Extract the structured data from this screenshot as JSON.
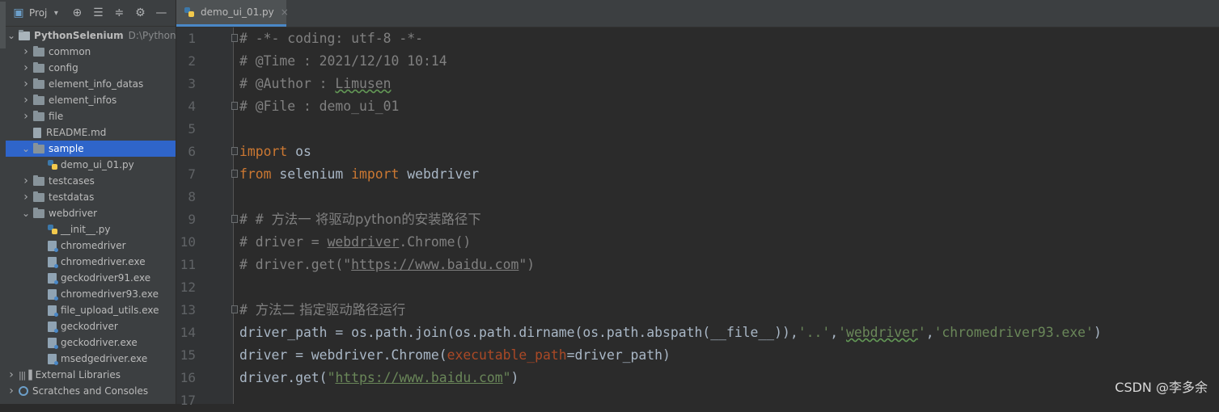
{
  "sidebar": {
    "header": {
      "title": "Proj",
      "icons": [
        "target-icon",
        "collapse-icon",
        "expand-icon",
        "gear-icon",
        "minimize-icon"
      ]
    },
    "tree": [
      {
        "label": "PythonSelenium",
        "hint": "D:\\PythonS",
        "depth": 0,
        "type": "root",
        "open": true
      },
      {
        "label": "common",
        "depth": 1,
        "type": "folder",
        "open": false
      },
      {
        "label": "config",
        "depth": 1,
        "type": "folder",
        "open": false
      },
      {
        "label": "element_info_datas",
        "depth": 1,
        "type": "folder",
        "open": false
      },
      {
        "label": "element_infos",
        "depth": 1,
        "type": "folder",
        "open": false
      },
      {
        "label": "file",
        "depth": 1,
        "type": "folder",
        "open": false
      },
      {
        "label": "README.md",
        "depth": 1,
        "type": "md"
      },
      {
        "label": "sample",
        "depth": 1,
        "type": "folder",
        "open": true,
        "selected": true
      },
      {
        "label": "demo_ui_01.py",
        "depth": 2,
        "type": "py"
      },
      {
        "label": "testcases",
        "depth": 1,
        "type": "folder",
        "open": false
      },
      {
        "label": "testdatas",
        "depth": 1,
        "type": "folder",
        "open": false
      },
      {
        "label": "webdriver",
        "depth": 1,
        "type": "folder",
        "open": true
      },
      {
        "label": "__init__.py",
        "depth": 2,
        "type": "py"
      },
      {
        "label": "chromedriver",
        "depth": 2,
        "type": "bin"
      },
      {
        "label": "chromedriver.exe",
        "depth": 2,
        "type": "bin"
      },
      {
        "label": "geckodriver91.exe",
        "depth": 2,
        "type": "bin"
      },
      {
        "label": "chromedriver93.exe",
        "depth": 2,
        "type": "bin"
      },
      {
        "label": "file_upload_utils.exe",
        "depth": 2,
        "type": "bin"
      },
      {
        "label": "geckodriver",
        "depth": 2,
        "type": "bin"
      },
      {
        "label": "geckodriver.exe",
        "depth": 2,
        "type": "bin"
      },
      {
        "label": "msedgedriver.exe",
        "depth": 2,
        "type": "bin"
      },
      {
        "label": "External Libraries",
        "depth": 0,
        "type": "libs",
        "open": false
      },
      {
        "label": "Scratches and Consoles",
        "depth": 0,
        "type": "scratch",
        "open": false
      }
    ]
  },
  "editor": {
    "tab": {
      "label": "demo_ui_01.py",
      "close": "×"
    },
    "lines": [
      {
        "n": "1",
        "fold": true,
        "segs": [
          [
            "c",
            "# -*- coding: utf-8 -*-"
          ]
        ]
      },
      {
        "n": "2",
        "segs": [
          [
            "c",
            "# @Time : 2021/12/10 10:14"
          ]
        ]
      },
      {
        "n": "3",
        "segs": [
          [
            "c",
            "# @Author : "
          ],
          [
            "c w",
            "Limusen"
          ]
        ]
      },
      {
        "n": "4",
        "fold": true,
        "segs": [
          [
            "c",
            "# @File : demo_ui_01"
          ]
        ]
      },
      {
        "n": "5",
        "segs": []
      },
      {
        "n": "6",
        "fold": true,
        "segs": [
          [
            "k",
            "import"
          ],
          [
            "",
            " os"
          ]
        ]
      },
      {
        "n": "7",
        "fold": true,
        "segs": [
          [
            "k",
            "from"
          ],
          [
            "",
            " selenium "
          ],
          [
            "k",
            "import"
          ],
          [
            "",
            " webdriver"
          ]
        ]
      },
      {
        "n": "8",
        "segs": []
      },
      {
        "n": "9",
        "fold": true,
        "segs": [
          [
            "c",
            "# # "
          ],
          [
            "c cn",
            "方法一 将驱动python的安装路径下"
          ]
        ]
      },
      {
        "n": "10",
        "segs": [
          [
            "c",
            "# driver = "
          ],
          [
            "c u",
            "webdriver"
          ],
          [
            "c",
            ".Chrome()"
          ]
        ]
      },
      {
        "n": "11",
        "segs": [
          [
            "c",
            "# driver.get(\""
          ],
          [
            "c u",
            "https://www.baidu.com"
          ],
          [
            "c",
            "\")"
          ]
        ]
      },
      {
        "n": "12",
        "segs": []
      },
      {
        "n": "13",
        "fold": true,
        "segs": [
          [
            "c",
            "# "
          ],
          [
            "c cn",
            "方法二 指定驱动路径运行"
          ]
        ]
      },
      {
        "n": "14",
        "segs": [
          [
            "",
            "driver_path = os.path.join(os.path.dirname(os.path.abspath(__file__)),"
          ],
          [
            "s",
            "'..'"
          ],
          [
            "",
            ","
          ],
          [
            "s",
            "'"
          ],
          [
            "s w",
            "webdriver"
          ],
          [
            "s",
            "'"
          ],
          [
            "",
            ","
          ],
          [
            "s",
            "'chromedriver93.exe'"
          ],
          [
            "",
            ")"
          ]
        ]
      },
      {
        "n": "15",
        "segs": [
          [
            "",
            "driver = webdriver.Chrome("
          ],
          [
            "p",
            "executable_path"
          ],
          [
            "",
            "=driver_path)"
          ]
        ]
      },
      {
        "n": "16",
        "segs": [
          [
            "",
            "driver.get("
          ],
          [
            "s",
            "\""
          ],
          [
            "s u",
            "https://www.baidu.com"
          ],
          [
            "s",
            "\""
          ],
          [
            "",
            ")"
          ]
        ]
      },
      {
        "n": "17",
        "segs": []
      }
    ]
  },
  "watermark": "CSDN @李多余"
}
